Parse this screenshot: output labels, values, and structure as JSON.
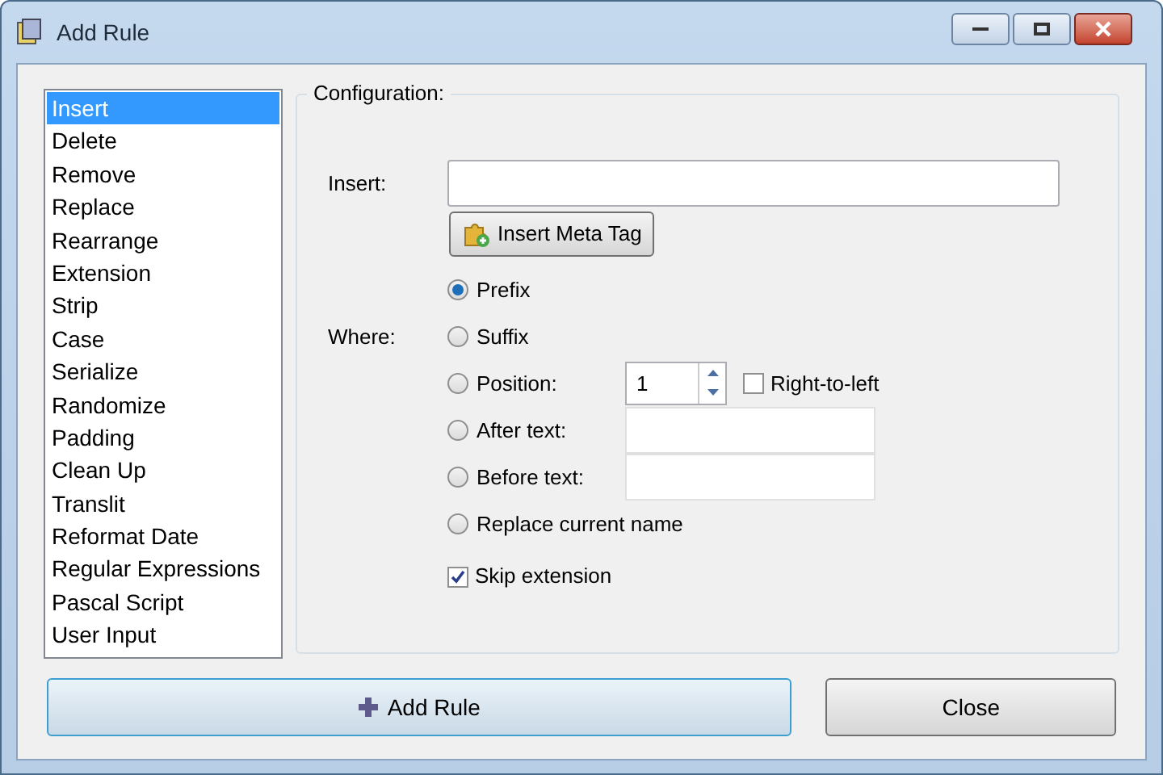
{
  "window": {
    "title": "Add Rule"
  },
  "rules": [
    {
      "label": "Insert",
      "selected": true
    },
    {
      "label": "Delete",
      "selected": false
    },
    {
      "label": "Remove",
      "selected": false
    },
    {
      "label": "Replace",
      "selected": false
    },
    {
      "label": "Rearrange",
      "selected": false
    },
    {
      "label": "Extension",
      "selected": false
    },
    {
      "label": "Strip",
      "selected": false
    },
    {
      "label": "Case",
      "selected": false
    },
    {
      "label": "Serialize",
      "selected": false
    },
    {
      "label": "Randomize",
      "selected": false
    },
    {
      "label": "Padding",
      "selected": false
    },
    {
      "label": "Clean Up",
      "selected": false
    },
    {
      "label": "Translit",
      "selected": false
    },
    {
      "label": "Reformat Date",
      "selected": false
    },
    {
      "label": "Regular Expressions",
      "selected": false
    },
    {
      "label": "Pascal Script",
      "selected": false
    },
    {
      "label": "User Input",
      "selected": false
    }
  ],
  "configuration": {
    "title": "Configuration:",
    "insert_label": "Insert:",
    "meta_tag_button": "Insert Meta Tag",
    "where_label": "Where:",
    "where_options": [
      {
        "label": "Prefix",
        "selected": true,
        "kind": "plain"
      },
      {
        "label": "Suffix",
        "selected": false,
        "kind": "plain"
      },
      {
        "label": "Position:",
        "selected": false,
        "kind": "spin",
        "value": "1",
        "checkbox": {
          "label": "Right-to-left",
          "checked": false
        }
      },
      {
        "label": "After text:",
        "selected": false,
        "kind": "text"
      },
      {
        "label": "Before text:",
        "selected": false,
        "kind": "text"
      },
      {
        "label": "Replace current name",
        "selected": false,
        "kind": "plain"
      }
    ],
    "skip_extension": {
      "label": "Skip extension",
      "checked": true
    }
  },
  "buttons": {
    "add_rule": "Add Rule",
    "close": "Close"
  }
}
